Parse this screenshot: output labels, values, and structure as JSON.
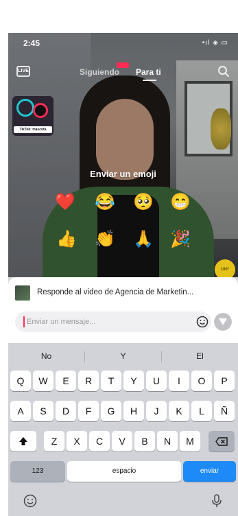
{
  "status": {
    "time": "2:45",
    "icons": "•ıl ◈ ▭"
  },
  "header": {
    "live_label": "LIVE",
    "tabs": [
      {
        "label": "Siguiendo"
      },
      {
        "label": "Para ti"
      }
    ]
  },
  "promo": {
    "label": "TikTok: mascota"
  },
  "emoji_picker": {
    "title": "Enviar un emoji",
    "emojis": [
      "❤️",
      "😂",
      "🥺",
      "😁",
      "👍",
      "👏",
      "🙏",
      "🎉"
    ]
  },
  "coin": {
    "label": "100°"
  },
  "reply": {
    "text": "Responde al video de Agencia de Marketin...",
    "placeholder": "Enviar un mensaje..."
  },
  "keyboard": {
    "suggestions": [
      "No",
      "Y",
      "El"
    ],
    "row1": [
      "Q",
      "W",
      "E",
      "R",
      "T",
      "Y",
      "U",
      "I",
      "O",
      "P"
    ],
    "row2": [
      "A",
      "S",
      "D",
      "F",
      "G",
      "H",
      "J",
      "K",
      "L",
      "Ñ"
    ],
    "row3": [
      "Z",
      "X",
      "C",
      "V",
      "B",
      "N",
      "M"
    ],
    "numbers_label": "123",
    "space_label": "espacio",
    "send_label": "enviar"
  },
  "colors": {
    "accent": "#fe2c55",
    "send_key": "#1d8af7"
  }
}
